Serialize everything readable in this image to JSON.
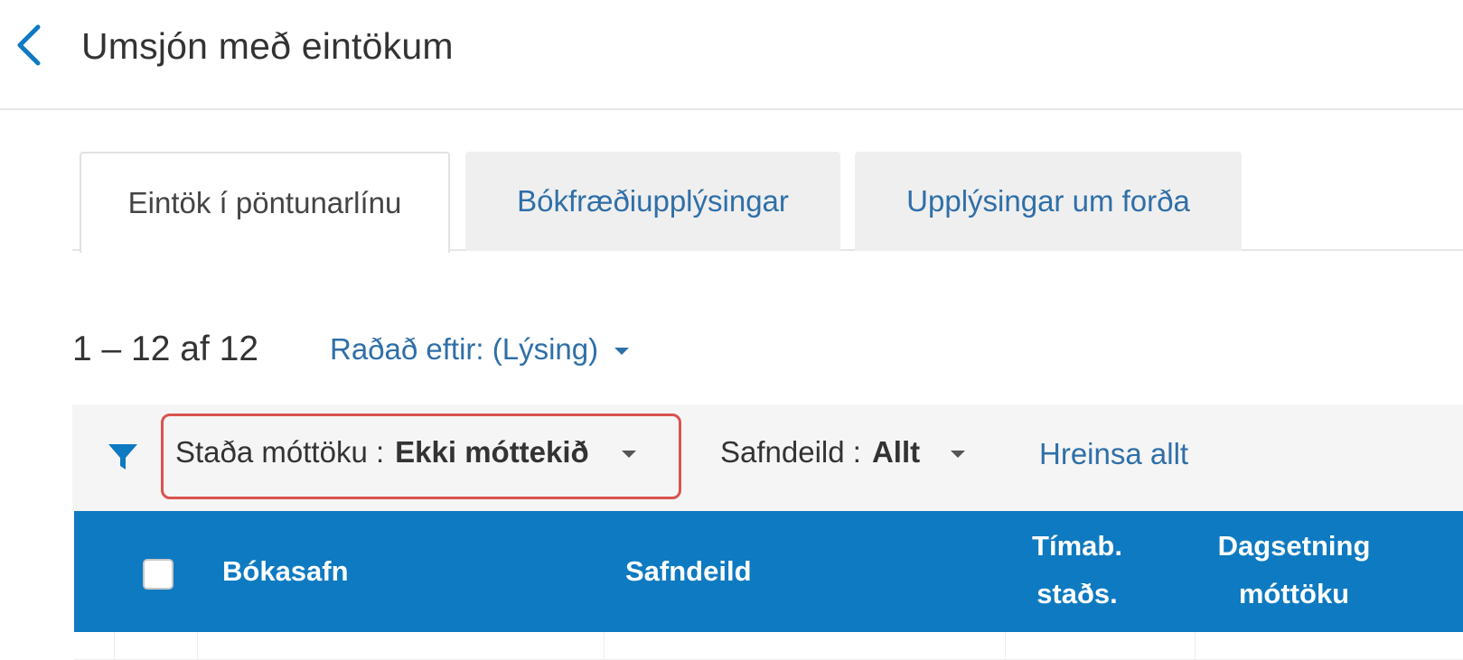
{
  "header": {
    "title": "Umsjón með eintökum"
  },
  "tabs": [
    {
      "label": "Eintök í pöntunarlínu",
      "active": true
    },
    {
      "label": "Bókfræðiupplýsingar",
      "active": false
    },
    {
      "label": "Upplýsingar um forða",
      "active": false
    }
  ],
  "results": {
    "count_label": "1 – 12 af 12",
    "sort_label": "Raðað eftir: (Lýsing)"
  },
  "filters": {
    "receiving_status": {
      "label": "Staða móttöku :",
      "value": "Ekki móttekið"
    },
    "location": {
      "label": "Safndeild :",
      "value": "Allt"
    },
    "clear_all": "Hreinsa allt"
  },
  "table": {
    "columns": {
      "library": "Bókasafn",
      "location": "Safndeild",
      "temp_status_line1": "Tímab.",
      "temp_status_line2": "staðs.",
      "receive_date_line1": "Dagsetning",
      "receive_date_line2": "móttöku"
    }
  },
  "colors": {
    "accent": "#0e7ac1",
    "link": "#2f6fa8",
    "highlight_border": "#d9534f"
  },
  "icons": [
    "chevron-left-icon",
    "filter-icon",
    "caret-down-icon"
  ]
}
